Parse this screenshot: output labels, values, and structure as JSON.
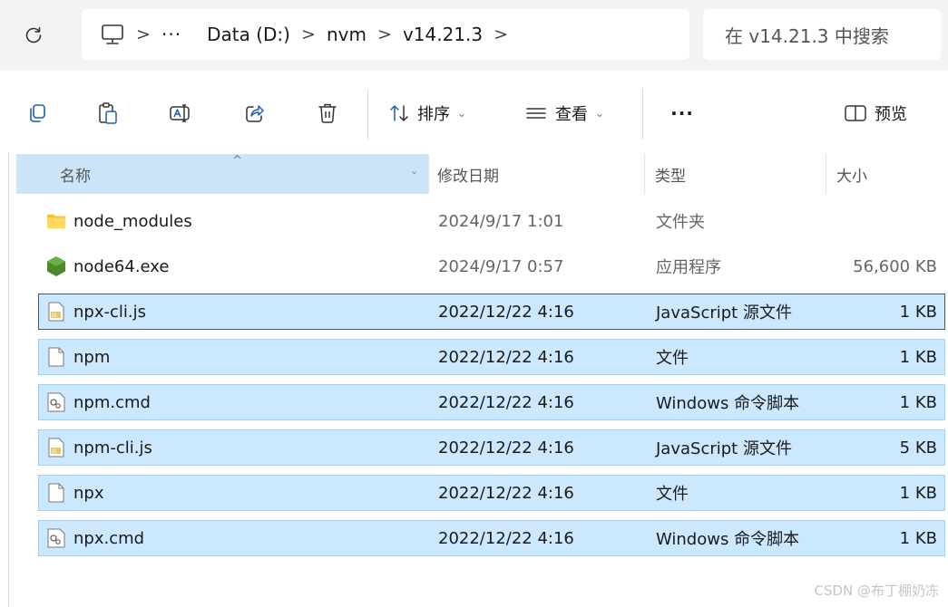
{
  "address_bar": {
    "breadcrumb": [
      "Data (D:)",
      "nvm",
      "v14.21.3"
    ],
    "overflow_label": "···",
    "separator": ">",
    "search_placeholder": "在 v14.21.3 中搜索"
  },
  "command_bar": {
    "sort_label": "排序",
    "view_label": "查看",
    "more_label": "···",
    "preview_label": "预览",
    "caret": "⌄"
  },
  "columns": {
    "name": "名称",
    "date": "修改日期",
    "type": "类型",
    "size": "大小",
    "sort_indicator": "^",
    "dropdown": "⌄"
  },
  "files": [
    {
      "name": "node_modules",
      "date": "2024/9/17 1:01",
      "type": "文件夹",
      "size": "",
      "icon": "folder-icon",
      "selected": false
    },
    {
      "name": "node64.exe",
      "date": "2024/9/17 0:57",
      "type": "应用程序",
      "size": "56,600 KB",
      "icon": "node-exe-icon",
      "selected": false
    },
    {
      "name": "npx-cli.js",
      "date": "2022/12/22 4:16",
      "type": "JavaScript 源文件",
      "size": "1 KB",
      "icon": "js-file-icon",
      "selected": true
    },
    {
      "name": "npm",
      "date": "2022/12/22 4:16",
      "type": "文件",
      "size": "1 KB",
      "icon": "blank-file-icon",
      "selected": true
    },
    {
      "name": "npm.cmd",
      "date": "2022/12/22 4:16",
      "type": "Windows 命令脚本",
      "size": "1 KB",
      "icon": "cmd-file-icon",
      "selected": true
    },
    {
      "name": "npm-cli.js",
      "date": "2022/12/22 4:16",
      "type": "JavaScript 源文件",
      "size": "5 KB",
      "icon": "js-file-icon",
      "selected": true
    },
    {
      "name": "npx",
      "date": "2022/12/22 4:16",
      "type": "文件",
      "size": "1 KB",
      "icon": "blank-file-icon",
      "selected": true
    },
    {
      "name": "npx.cmd",
      "date": "2022/12/22 4:16",
      "type": "Windows 命令脚本",
      "size": "1 KB",
      "icon": "cmd-file-icon",
      "selected": true
    }
  ],
  "watermark": "CSDN @布丁棚奶冻",
  "colors": {
    "selection_bg": "#cce8ff",
    "selection_border": "#99d1ff",
    "header_highlight": "#cce4f7",
    "folder": "#f4c430",
    "node_green": "#4b8b2b",
    "icon_stroke": "#2b2b2b"
  }
}
